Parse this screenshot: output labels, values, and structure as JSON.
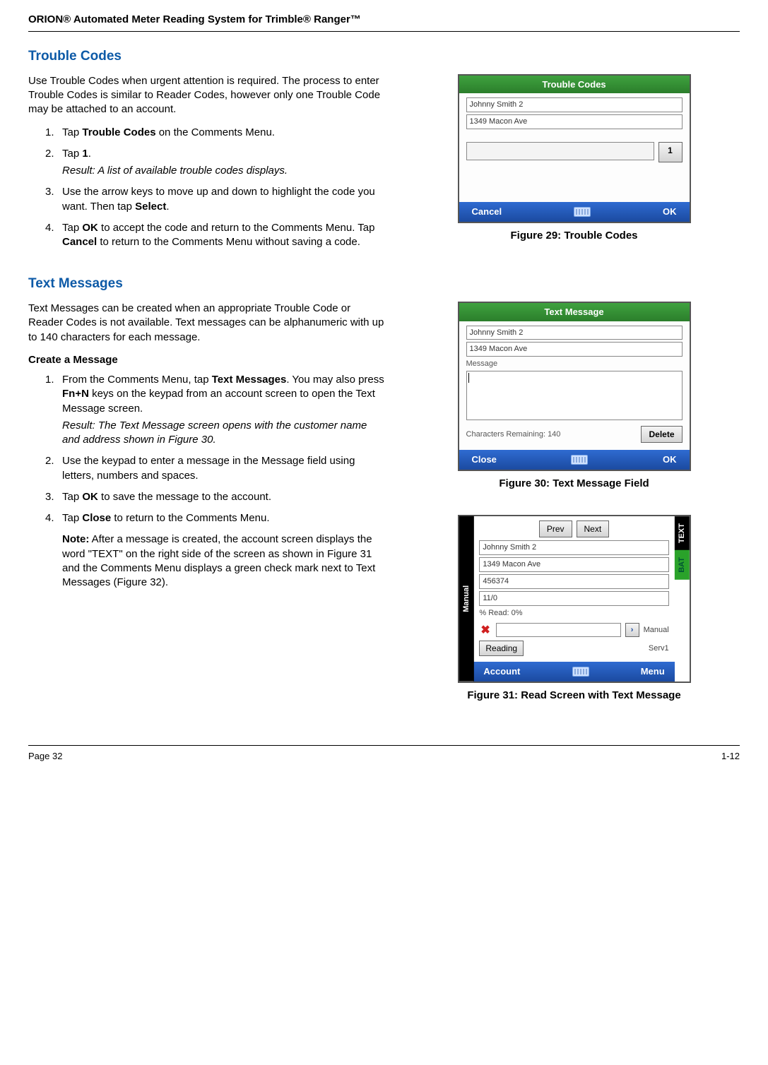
{
  "header": {
    "title": "ORION® Automated Meter Reading System for Trimble® Ranger™"
  },
  "section1": {
    "title": "Trouble Codes",
    "intro": "Use Trouble Codes when urgent attention is required. The process to enter Trouble Codes is similar to Reader Codes, however only one Trouble Code may be attached to an account.",
    "steps": {
      "s1": {
        "num": "1.",
        "pre": "Tap ",
        "bold": "Trouble Codes",
        "post": " on the Comments Menu."
      },
      "s2": {
        "num": "2.",
        "pre": "Tap ",
        "bold": "1",
        "post": ".",
        "result": "Result: A list of available trouble codes displays."
      },
      "s3": {
        "num": "3.",
        "text": "Use the arrow keys to move up and down to highlight the code you want. Then tap ",
        "bold": "Select",
        "post": "."
      },
      "s4": {
        "num": "4.",
        "pre": "Tap ",
        "bold1": "OK",
        "mid": " to accept the code and return to the Comments Menu. Tap ",
        "bold2": "Cancel",
        "post": " to return to the Comments Menu without saving a code."
      }
    },
    "fig": {
      "caption": "Figure 29:  Trouble Codes",
      "title": "Trouble Codes",
      "line1": "Johnny Smith 2",
      "line2": "1349 Macon Ave",
      "btn": "1",
      "cancel": "Cancel",
      "ok": "OK"
    }
  },
  "section2": {
    "title": "Text Messages",
    "intro": "Text Messages can be created when an appropriate Trouble Code or Reader Codes is not available. Text messages can be alphanumeric with up to 140 characters for each message.",
    "createHead": "Create a Message",
    "steps": {
      "s1": {
        "num": "1.",
        "pre": "From the Comments Menu, tap ",
        "bold1": "Text Messages",
        "mid": ". You may also press ",
        "bold2": "Fn+N",
        "post": " keys on the keypad from an account screen to open the Text Message screen.",
        "result": "Result: The Text Message screen opens with the customer name and address shown in Figure 30."
      },
      "s2": {
        "num": "2.",
        "text": "Use the keypad to enter a message in the Message field using letters, numbers and spaces."
      },
      "s3": {
        "num": "3.",
        "pre": "Tap ",
        "bold": "OK",
        "post": " to save the message to the account."
      },
      "s4": {
        "num": "4.",
        "pre": "Tap ",
        "bold": "Close",
        "post": " to return to the Comments Menu."
      }
    },
    "note": {
      "bold": "Note:",
      "text": " After a message is created, the account screen displays the word \"TEXT\" on the right side of the screen as shown in Figure 31 and the Comments Menu displays a green check mark next to Text Messages (Figure 32)."
    },
    "fig30": {
      "caption": "Figure 30:  Text Message Field",
      "title": "Text Message",
      "line1": "Johnny Smith 2",
      "line2": "1349 Macon Ave",
      "msgLabel": "Message",
      "chars": "Characters Remaining:  140",
      "delete": "Delete",
      "close": "Close",
      "ok": "OK"
    },
    "fig31": {
      "caption": "Figure 31:  Read Screen with Text Message",
      "manual": "Manual",
      "prev": "Prev",
      "next": "Next",
      "line1": "Johnny Smith 2",
      "line2": "1349 Macon Ave",
      "line3": "456374",
      "line4": "11/0",
      "pct": "% Read: 0%",
      "manualLbl": "Manual",
      "reading": "Reading",
      "serv": "Serv1",
      "account": "Account",
      "menu": "Menu",
      "textTab": "TEXT",
      "batTab": "BAT"
    }
  },
  "footer": {
    "left": "Page 32",
    "right": "1-12"
  }
}
